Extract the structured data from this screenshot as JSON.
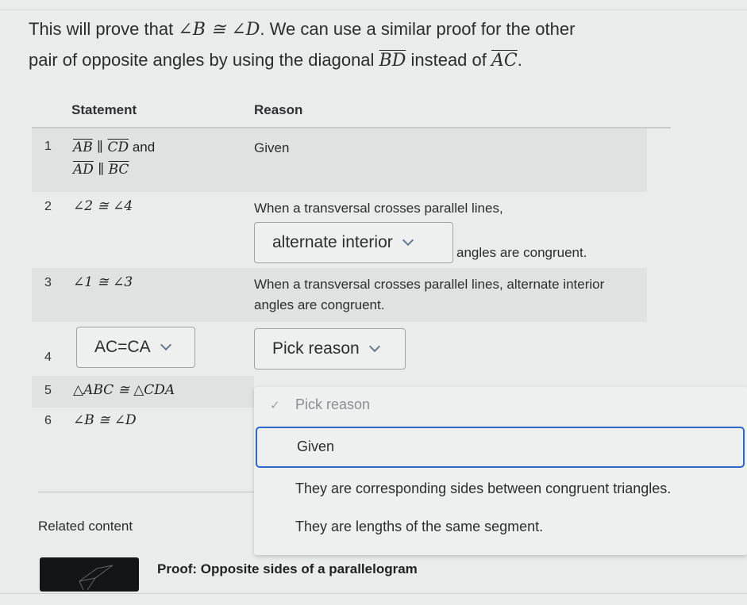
{
  "intro": {
    "line1_pre": "This will prove that ",
    "line1_math": "∠B ≅ ∠D",
    "line1_post": ". We can use a similar proof for the other",
    "line2_pre": "pair of opposite angles by using the diagonal ",
    "line2_seg1": "BD",
    "line2_mid": " instead of ",
    "line2_seg2": "AC",
    "line2_post": "."
  },
  "table": {
    "headers": {
      "statement": "Statement",
      "reason": "Reason"
    },
    "rows": [
      {
        "num": "1",
        "stmt_a1": "AB",
        "stmt_par": " ∥ ",
        "stmt_a2": "CD",
        "stmt_and": " and",
        "stmt_b1": "AD",
        "stmt_b2": "BC",
        "reason": "Given"
      },
      {
        "num": "2",
        "stmt": "∠2 ≅ ∠4",
        "reason_pre": "When a transversal crosses parallel lines,",
        "reason_select": "alternate interior",
        "reason_post": "angles are congruent."
      },
      {
        "num": "3",
        "stmt": "∠1 ≅ ∠3",
        "reason_line1": "When a transversal crosses parallel lines, alternate interior",
        "reason_line2": "angles are congruent."
      },
      {
        "num": "4",
        "stmt_select": "AC=CA",
        "reason_select": "Pick reason"
      },
      {
        "num": "5",
        "stmt": "△ABC ≅ △CDA"
      },
      {
        "num": "6",
        "stmt": "∠B ≅ ∠D"
      }
    ]
  },
  "dropdown_menu": {
    "options": [
      {
        "label": "Pick reason",
        "state": "placeholder-checked"
      },
      {
        "label": "Given",
        "state": "highlighted"
      },
      {
        "label": "They are corresponding sides between congruent triangles.",
        "state": "normal"
      },
      {
        "label": "They are lengths of the same segment.",
        "state": "normal"
      }
    ]
  },
  "related": {
    "title": "Related content",
    "items": [
      {
        "label": "Proof: Opposite sides of a parallelogram"
      }
    ]
  },
  "colors": {
    "focus_border": "#2f67c6",
    "row_shade": "#dfe2e1",
    "background": "#e9ecea"
  }
}
